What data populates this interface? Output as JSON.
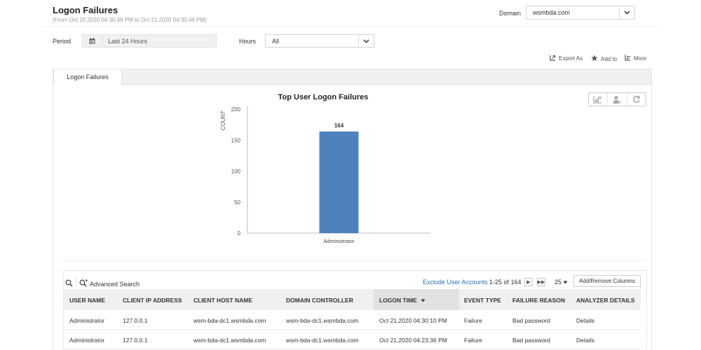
{
  "header": {
    "title": "Logon Failures",
    "subtitle": "(From Oct 20,2020 04:30:49 PM to Oct 21,2020 04:30:49 PM)",
    "domain_label": "Domain",
    "domain_value": "wsmbda.com"
  },
  "filters": {
    "period_label": "Period",
    "period_value": "Last 24 Hours",
    "hours_label": "Hours",
    "hours_value": "All"
  },
  "actions": {
    "export": "Export As",
    "add_to": "Add to",
    "more": "More"
  },
  "tabs": [
    {
      "label": "Logon Failures"
    }
  ],
  "chart_icons": [
    "chart-add-icon",
    "user-filter-icon",
    "refresh-icon"
  ],
  "chart_data": {
    "type": "bar",
    "title": "Top User Logon Failures",
    "categories": [
      "Administrator"
    ],
    "values": [
      164
    ],
    "data_labels": [
      "164"
    ],
    "xlabel": "",
    "ylabel": "COUNT",
    "ylim": [
      0,
      200
    ],
    "yticks": [
      0,
      50,
      100,
      150,
      200
    ],
    "bar_color": "#4f81bd",
    "grid": false
  },
  "grid": {
    "advanced_search": "Advanced Search",
    "exclude_link": "Exclude User Accounts",
    "range": "1-25 of 164",
    "page_size": "25",
    "columns_button": "Add/Remove Columns",
    "columns": [
      "USER NAME",
      "CLIENT IP ADDRESS",
      "CLIENT HOST NAME",
      "DOMAIN CONTROLLER",
      "LOGON TIME",
      "EVENT TYPE",
      "FAILURE REASON",
      "ANALYZER DETAILS"
    ],
    "rows": [
      {
        "user": "Administrator",
        "ip": "127.0.0.1",
        "host": "wsm-bda-dc1.wsmbda.com",
        "dc": "wsm-bda-dc1.wsmbda.com",
        "time": "Oct 21,2020 04:30:10 PM",
        "event": "Failure",
        "reason": "Bad password",
        "details": "Details"
      },
      {
        "user": "Administrator",
        "ip": "127.0.0.1",
        "host": "wsm-bda-dc1.wsmbda.com",
        "dc": "wsm-bda-dc1.wsmbda.com",
        "time": "Oct 21,2020 04:23:36 PM",
        "event": "Failure",
        "reason": "Bad password",
        "details": "Details"
      }
    ]
  },
  "colors": {
    "accent_link": "#2a6fb5",
    "bar": "#4f81bd",
    "header_bg": "#f0f0f0"
  }
}
